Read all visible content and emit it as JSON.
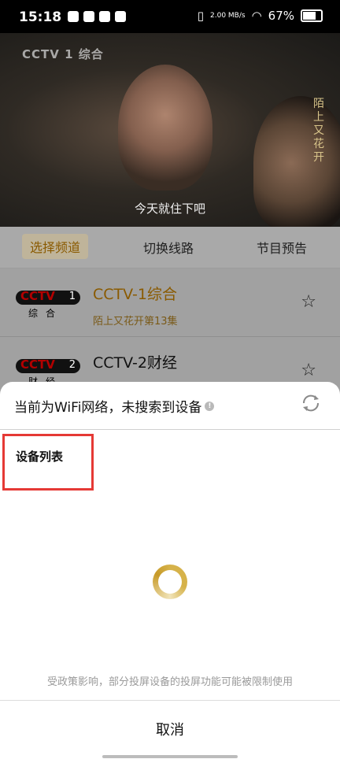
{
  "status_bar": {
    "time": "15:18",
    "speed": "2.00 MB/s",
    "battery": "67%"
  },
  "player": {
    "channel_logo": "CCTV 1 综合",
    "subtitle": "今天就住下吧",
    "side_title": "陌上又花开"
  },
  "tabs": [
    "选择频道",
    "切换线路",
    "节目预告"
  ],
  "channels": [
    {
      "logo_num": "1",
      "logo_cn": "综合",
      "name": "CCTV-1综合",
      "program": "陌上又花开第13集",
      "active": true
    },
    {
      "logo_num": "2",
      "logo_cn": "财经",
      "name": "CCTV-2财经",
      "program": "",
      "active": false
    }
  ],
  "sheet": {
    "header": "当前为WiFi网络，未搜索到设备",
    "list_title": "设备列表",
    "notice": "受政策影响，部分投屏设备的投屏功能可能被限制使用",
    "cancel": "取消"
  },
  "colors": {
    "accent_gold": "#d6b24a",
    "highlight_red": "#e53935"
  },
  "icons": [
    "info-icon",
    "refresh-icon",
    "star-add-icon",
    "loading-spinner"
  ]
}
